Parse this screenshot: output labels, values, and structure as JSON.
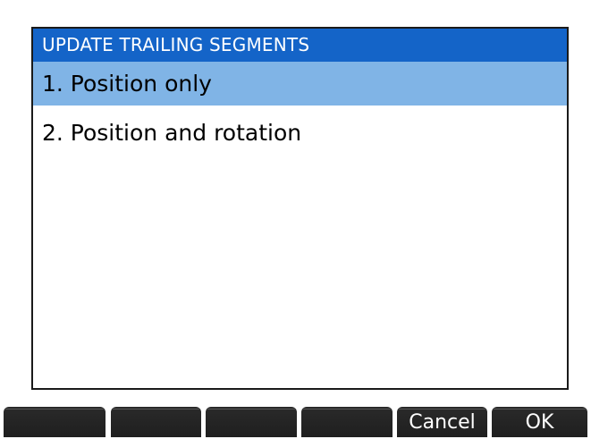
{
  "dialog": {
    "title": "UPDATE TRAILING SEGMENTS",
    "options": [
      {
        "label": "1. Position only",
        "selected": true
      },
      {
        "label": "2. Position and rotation",
        "selected": false
      }
    ]
  },
  "softkeys": {
    "key1": "",
    "key2": "",
    "key3": "",
    "key4": "",
    "key5": "Cancel",
    "key6": "OK"
  },
  "colors": {
    "title_bar": "#1464c8",
    "selected_row": "#80b4e6",
    "softkey": "#222222"
  }
}
